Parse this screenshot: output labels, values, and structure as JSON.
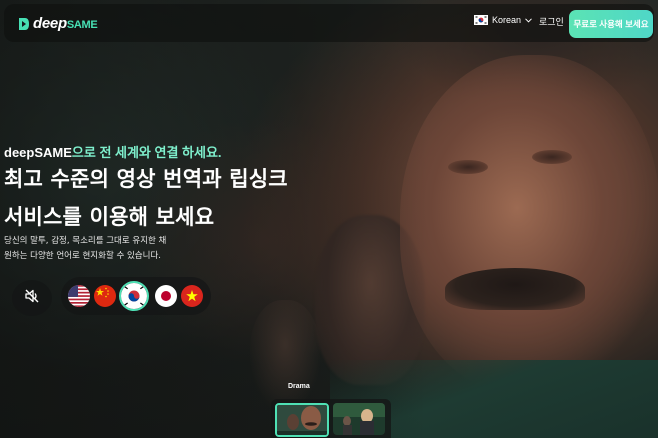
{
  "nav": {
    "logo_deep": "deep",
    "logo_same": "SAME",
    "language": "Korean",
    "login": "로그인",
    "cta": "무료로 사용해 보세요"
  },
  "hero": {
    "tagline_brand": "deepSAME",
    "tagline_rest": "으로 전 세계와 연결 하세요.",
    "headline_line1": "최고 수준의 영상 번역과 립싱크",
    "headline_line2": "서비스를 이용해 보세요",
    "sub_line1": "당신의 말투, 감정, 목소리를 그대로 유지한 채",
    "sub_line2": "원하는 다양한 언어로 현지화할 수 있습니다."
  },
  "controls": {
    "mute_icon": "speaker-muted-icon",
    "flags": [
      {
        "name": "us-flag-icon",
        "active": false
      },
      {
        "name": "cn-flag-icon",
        "active": false
      },
      {
        "name": "kr-flag-icon",
        "active": true
      },
      {
        "name": "jp-flag-icon",
        "active": false
      },
      {
        "name": "vn-flag-icon",
        "active": false
      }
    ]
  },
  "drama": {
    "label": "Drama"
  },
  "colors": {
    "accent": "#4fe0b4",
    "tagline_accent": "#7ff0cd",
    "cta_gradient_start": "#5be3b4",
    "cta_gradient_end": "#4fd7c7"
  }
}
